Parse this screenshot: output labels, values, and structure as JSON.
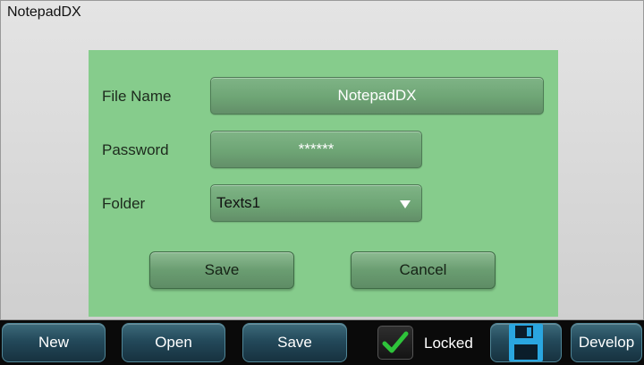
{
  "window": {
    "title": "NotepadDX"
  },
  "form": {
    "file_name_label": "File Name",
    "file_name_value": "NotepadDX",
    "password_label": "Password",
    "password_value": "******",
    "folder_label": "Folder",
    "folder_value": "Texts1",
    "save_label": "Save",
    "cancel_label": "Cancel"
  },
  "toolbar": {
    "new_label": "New",
    "open_label": "Open",
    "save_label": "Save",
    "locked_label": "Locked",
    "locked_checked": true,
    "develop_label": "Develop",
    "save_icon": "floppy-disk-icon"
  },
  "colors": {
    "dialog_bg": "#86cc8c",
    "toolbar_btn": "#23495a",
    "check": "#2ec43a",
    "floppy": "#2aa6e0"
  }
}
